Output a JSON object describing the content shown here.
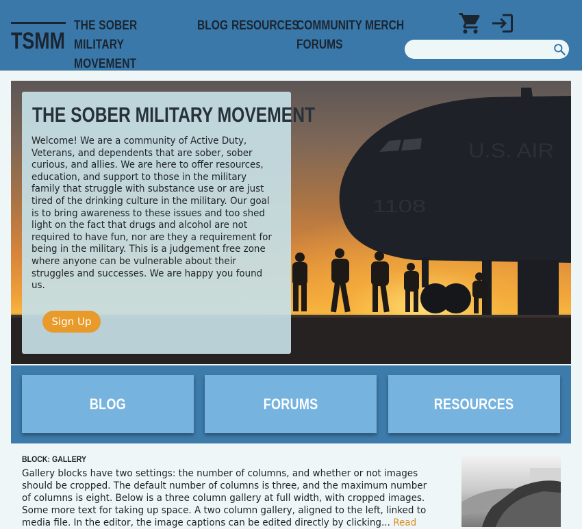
{
  "header": {
    "logo_text": "TSMM",
    "site_title": "THE SOBER MILITARY MOVEMENT",
    "nav": [
      {
        "label": "BLOG"
      },
      {
        "label": "RESOURCES"
      },
      {
        "label": "COMMUNITY\nFORUMS"
      },
      {
        "label": "MERCH"
      }
    ],
    "icons": {
      "cart": "cart-icon",
      "login": "login-icon",
      "search": "search-icon"
    },
    "search": {
      "placeholder": "",
      "value": ""
    }
  },
  "hero": {
    "title": "THE SOBER MILITARY MOVEMENT",
    "text": "Welcome! We are a community of Active Duty, Veterans, and dependents that are sober, sober curious, and allies. We are here to offer resources, education, and support to those in the military family that struggle with substance use or are just tired of the drinking culture in the military. Our goal is to bring awareness to these issues and too shed light on the fact that drugs and alcohol are not required to have fun, nor are they a requirement for being in the military. This is a judgement free zone where anyone can be vulnerable about their struggles and successes. We are happy you found us.",
    "cta_label": "Sign Up",
    "aircraft_text": "U.S. AIR",
    "aircraft_number": "1108"
  },
  "feature_cards": [
    {
      "label": "BLOG"
    },
    {
      "label": "FORUMS"
    },
    {
      "label": "RESOURCES"
    }
  ],
  "gallery_block": {
    "label": "BLOCK: GALLERY",
    "text": "Gallery blocks have two settings: the number of columns, and whether or not images should be cropped. The default number of columns is three, and the maximum number of columns is eight. Below is a three column gallery at full width, with cropped images. Some more text for taking up space. A two column gallery, aligned to the left, linked to media file. In the editor, the image captions can be edited directly by clicking...",
    "read_more": "Read"
  },
  "colors": {
    "header_bg": "#3a78a9",
    "page_bg": "#eef6f7",
    "accent_orange": "#e89a2a",
    "card_blue": "#76b3df",
    "band_blue": "#3d7bab",
    "text_dark": "#1b2531"
  }
}
